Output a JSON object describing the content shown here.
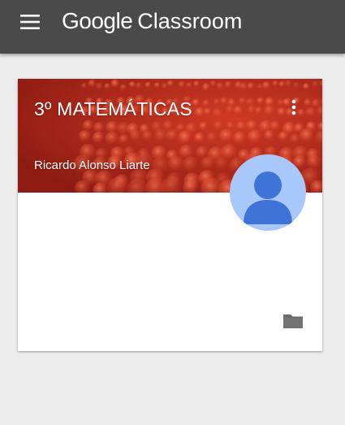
{
  "app": {
    "brand_google": "Google",
    "brand_product": "Classroom",
    "menu_icon": "hamburger-menu-icon",
    "bar_color": "#4a4a4a"
  },
  "course_card": {
    "title": "3º MATEMÁTICAS",
    "teacher": "Ricardo Alonso Liarte",
    "header_color": "#a82318",
    "more_icon": "more-vert-icon",
    "avatar_icon": "default-user-avatar-icon",
    "folder_icon": "folder-icon"
  }
}
